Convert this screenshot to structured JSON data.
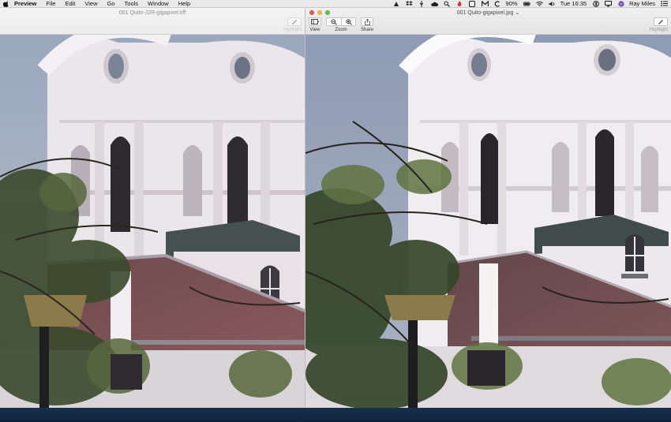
{
  "menubar": {
    "apple_icon": "apple-icon",
    "items": [
      "Preview",
      "File",
      "Edit",
      "View",
      "Go",
      "Tools",
      "Window",
      "Help"
    ],
    "status": {
      "battery": "90%",
      "time": "Tue 16:35",
      "user": "Ray Miles"
    }
  },
  "windows": {
    "left": {
      "title": "001 Quito-J2R-gigapixel.tiff",
      "highlight_label": "Highlight"
    },
    "right": {
      "title": "001 Quito-gigapixel.jpg",
      "toolbar": {
        "view_label": "View",
        "zoom_label": "Zoom",
        "share_label": "Share",
        "highlight_label": "Highlight"
      }
    }
  },
  "colors": {
    "close": "#ee5d55",
    "minimize": "#f5bd4f",
    "maximize": "#60c454",
    "desktop": "#17304f"
  }
}
